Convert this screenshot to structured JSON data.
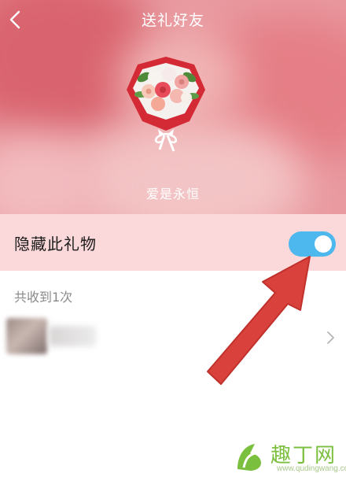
{
  "header": {
    "title": "送礼好友",
    "back_icon": "chevron-left-icon"
  },
  "gift": {
    "name": "爱是永恒",
    "image": "rose-bouquet"
  },
  "settings": {
    "hide_gift_label": "隐藏此礼物",
    "hide_gift_enabled": true,
    "toggle_color": "#4db8ee"
  },
  "received": {
    "count_label": "共收到1次"
  },
  "sender": {
    "avatar": "blurred-avatar",
    "name": "",
    "chevron_icon": "chevron-right-icon"
  },
  "annotation": {
    "arrow_color": "#d9413c"
  },
  "watermark": {
    "brand": "趣丁网",
    "url": "www.qudingwang.com"
  }
}
